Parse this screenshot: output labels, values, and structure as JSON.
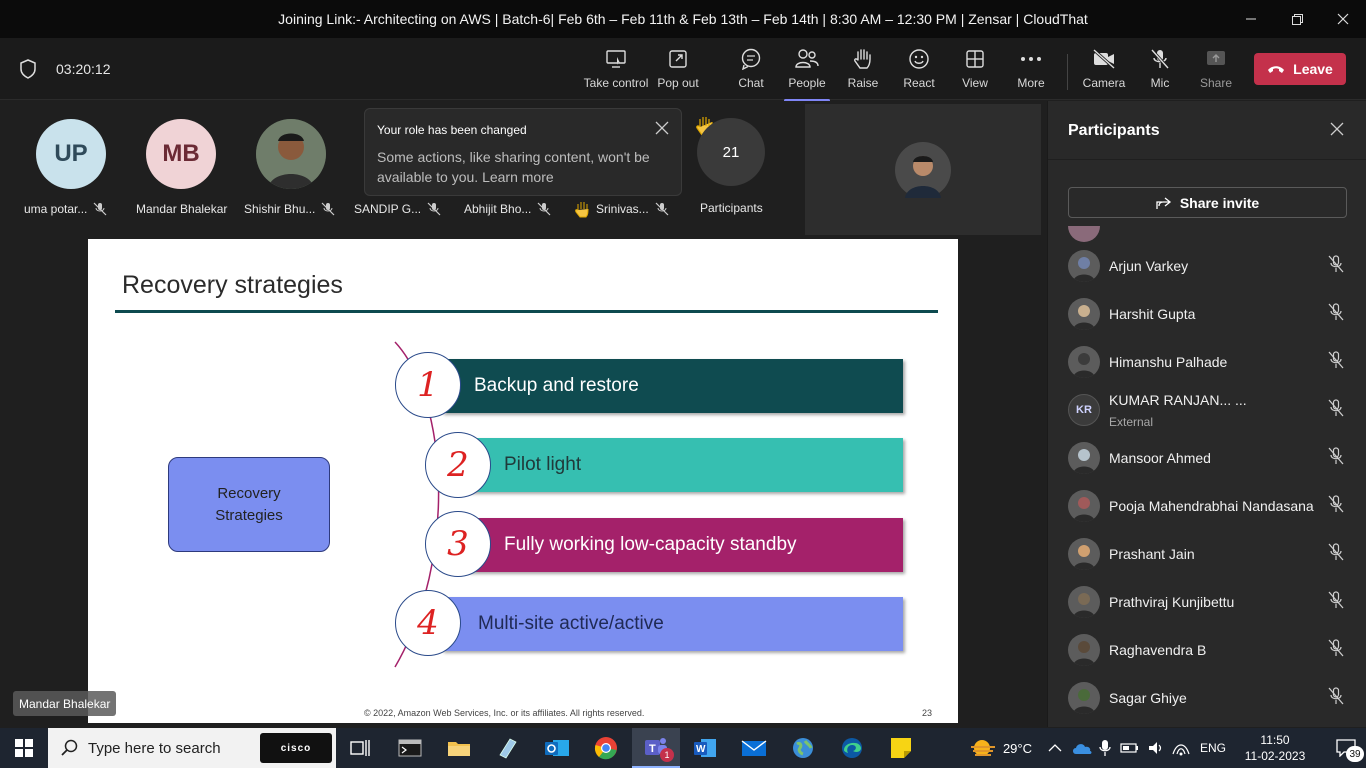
{
  "window": {
    "title": "Joining Link:- Architecting on AWS | Batch-6| Feb 6th – Feb 11th & Feb 13th – Feb 14th | 8:30 AM – 12:30 PM | Zensar | CloudThat"
  },
  "toolbar": {
    "timer": "03:20:12",
    "buttons": {
      "take_control": "Take control",
      "pop_out": "Pop out",
      "chat": "Chat",
      "people": "People",
      "raise": "Raise",
      "react": "React",
      "view": "View",
      "more": "More",
      "camera": "Camera",
      "mic": "Mic",
      "share": "Share"
    },
    "leave": "Leave"
  },
  "strip": {
    "tiles": [
      {
        "initials": "UP",
        "name": "uma potar...",
        "bg": "#c9e2ec",
        "fg": "#2f4a5a"
      },
      {
        "initials": "MB",
        "name": "Mandar Bhalekar",
        "bg": "#f0d3d6",
        "fg": "#6b2a35"
      },
      {
        "initials": "",
        "name": "Shishir Bhu...",
        "bg": "#555555",
        "fg": "#ffffff"
      }
    ],
    "names_extra": [
      "SANDIP G...",
      "Abhijit Bho...",
      "Srinivas..."
    ],
    "notification": {
      "title": "Your role has been changed",
      "body": "Some actions, like sharing content, won't be available to you. Learn more"
    },
    "participant_count": "21",
    "participant_label": "Participants"
  },
  "slide": {
    "title": "Recovery strategies",
    "left_box": "Recovery Strategies",
    "items": [
      {
        "num": "1",
        "label": "Backup and restore",
        "color": "#0f4b50"
      },
      {
        "num": "2",
        "label": "Pilot light",
        "color": "#36bfb1"
      },
      {
        "num": "3",
        "label": "Fully working low-capacity standby",
        "color": "#a4216a"
      },
      {
        "num": "4",
        "label": "Multi-site active/active",
        "color": "#7b8ef0"
      }
    ],
    "footer": "© 2022, Amazon Web Services, Inc. or its affiliates. All rights reserved.",
    "page": "23",
    "presenter": "Mandar Bhalekar"
  },
  "panel": {
    "title": "Participants",
    "share_invite": "Share invite",
    "participants": [
      {
        "name": "Arjun Varkey",
        "sub": "",
        "initials": "",
        "color": "#6f7fa5"
      },
      {
        "name": "Harshit Gupta",
        "sub": "",
        "initials": "",
        "color": "#c9b08f"
      },
      {
        "name": "Himanshu Palhade",
        "sub": "",
        "initials": "",
        "color": "#3c3c3c"
      },
      {
        "name": "KUMAR RANJAN... ...",
        "sub": "External",
        "initials": "KR",
        "color": "#e6e6f5"
      },
      {
        "name": "Mansoor Ahmed",
        "sub": "",
        "initials": "",
        "color": "#b6c3cc"
      },
      {
        "name": "Pooja Mahendrabhai Nandasana",
        "sub": "",
        "initials": "",
        "color": "#a05a5a"
      },
      {
        "name": "Prashant Jain",
        "sub": "",
        "initials": "",
        "color": "#d0a070"
      },
      {
        "name": "Prathviraj Kunjibettu",
        "sub": "",
        "initials": "",
        "color": "#7a6a55"
      },
      {
        "name": "Raghavendra B",
        "sub": "",
        "initials": "",
        "color": "#5a4a3a"
      },
      {
        "name": "Sagar Ghiye",
        "sub": "",
        "initials": "",
        "color": "#4a6a3a"
      }
    ]
  },
  "taskbar": {
    "search_placeholder": "Type here to search",
    "cisco_label": "cisco",
    "teams_badge": "1",
    "weather": "29°C",
    "language": "ENG",
    "time": "11:50",
    "date": "11-02-2023",
    "notif_count": "39"
  }
}
